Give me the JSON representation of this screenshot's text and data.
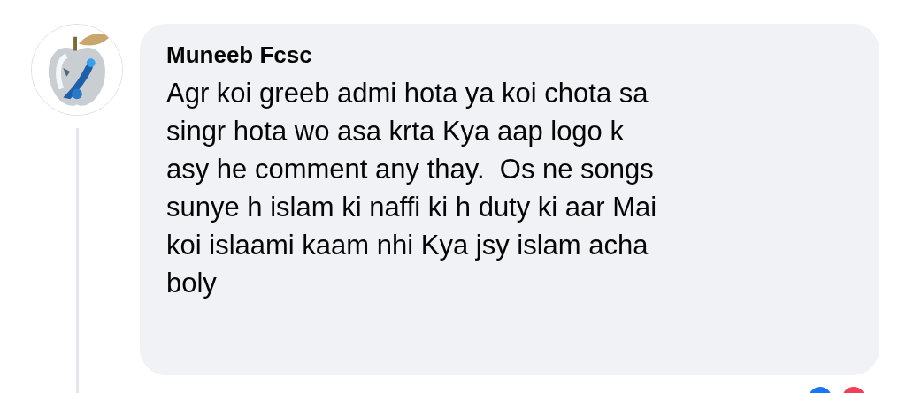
{
  "comment": {
    "author": "Muneeb Fcsc",
    "text": "Agr koi greeb admi hota ya koi chota sa\nsingr hota wo asa krta Kya aap logo k\nasy he comment any thay.  Os ne songs\nsunye h islam ki naffi ki h duty ki aar Mai\nkoi islaami kaam nhi Kya jsy islam acha\nboly"
  }
}
